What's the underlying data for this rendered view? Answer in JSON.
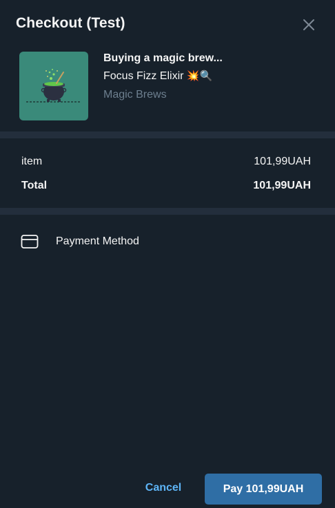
{
  "header": {
    "title": "Checkout (Test)",
    "close_icon": "close-icon"
  },
  "product": {
    "title": "Buying a magic brew...",
    "description": "Focus Fizz Elixir",
    "description_emoji": "💥🔍",
    "shop": "Magic Brews",
    "image_icon": "cauldron-icon"
  },
  "prices": [
    {
      "label": "item",
      "value": "101,99UAH"
    },
    {
      "label": "Total",
      "value": "101,99UAH"
    }
  ],
  "payment": {
    "label": "Payment Method",
    "icon": "credit-card-icon"
  },
  "footer": {
    "cancel_label": "Cancel",
    "pay_label": "Pay 101,99UAH"
  },
  "colors": {
    "background": "#17212b",
    "divider": "#232e3c",
    "accent": "#5eb5f7",
    "pay_button": "#2f6ea5",
    "muted_text": "#6d7f8f",
    "thumbnail": "#3a8a7a"
  }
}
